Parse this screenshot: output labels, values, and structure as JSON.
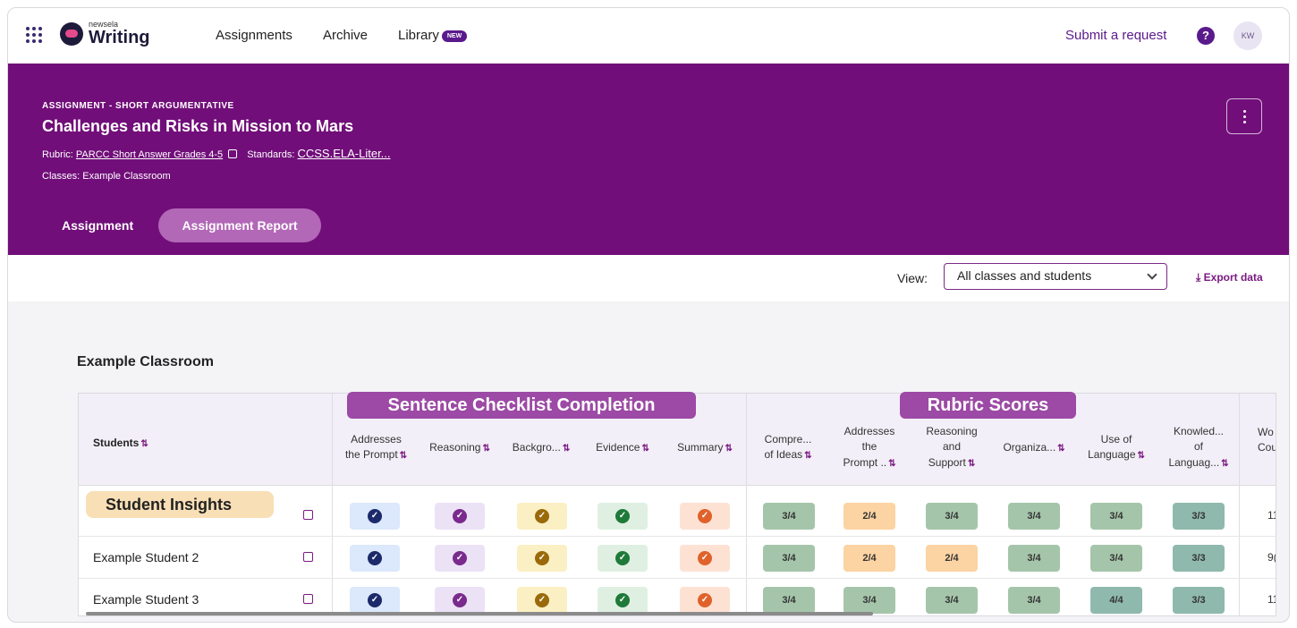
{
  "nav": {
    "logo_small": "newsela",
    "logo_big": "Writing",
    "links": [
      "Assignments",
      "Archive",
      "Library"
    ],
    "new_badge": "NEW",
    "submit": "Submit a request",
    "help": "?",
    "avatar": "KW"
  },
  "header": {
    "kicker": "ASSIGNMENT - SHORT ARGUMENTATIVE",
    "title": "Challenges and Risks in Mission to Mars",
    "rubric_label": "Rubric:",
    "rubric_value": "PARCC Short Answer Grades 4-5",
    "standards_label": "Standards:",
    "standards_value": "CCSS.ELA-Liter...",
    "classes": "Classes: Example Classroom",
    "tabs": [
      "Assignment",
      "Assignment Report"
    ]
  },
  "viewbar": {
    "label": "View:",
    "selected": "All classes and students",
    "export": "Export data"
  },
  "classroom_title": "Example Classroom",
  "table": {
    "students_header": "Students",
    "checklist_header": "Sentence Checklist Completion",
    "rubric_header": "Rubric Scores",
    "checklist_cols": [
      [
        "Addresses",
        "the Prompt"
      ],
      [
        "Reasoning"
      ],
      [
        "Backgro..."
      ],
      [
        "Evidence"
      ],
      [
        "Summary"
      ]
    ],
    "rubric_cols": [
      [
        "Compre...",
        "of Ideas"
      ],
      [
        "Addresses",
        "the",
        "Prompt .."
      ],
      [
        "Reasoning",
        "and",
        "Support"
      ],
      [
        "Organiza..."
      ],
      [
        "Use of",
        "Language"
      ],
      [
        "Knowled...",
        "of",
        "Languag..."
      ]
    ],
    "wc_header": [
      "Wo",
      "Cou"
    ],
    "rows": [
      {
        "name": "Student Insights",
        "scores": [
          "3/4",
          "2/4",
          "3/4",
          "3/4",
          "3/4",
          "3/3"
        ],
        "wc": "11"
      },
      {
        "name": "Example Student 2",
        "scores": [
          "3/4",
          "2/4",
          "2/4",
          "3/4",
          "3/4",
          "3/3"
        ],
        "wc": "9("
      },
      {
        "name": "Example Student 3",
        "scores": [
          "3/4",
          "3/4",
          "3/4",
          "3/4",
          "4/4",
          "3/3"
        ],
        "wc": "11"
      }
    ]
  },
  "colors": {
    "purple": "#710e79",
    "check_blue": "#1c2a6b",
    "check_purple": "#7a2a8c",
    "check_gold": "#9a6a0a",
    "check_green": "#1f7a3a",
    "check_orange": "#e0622a"
  }
}
